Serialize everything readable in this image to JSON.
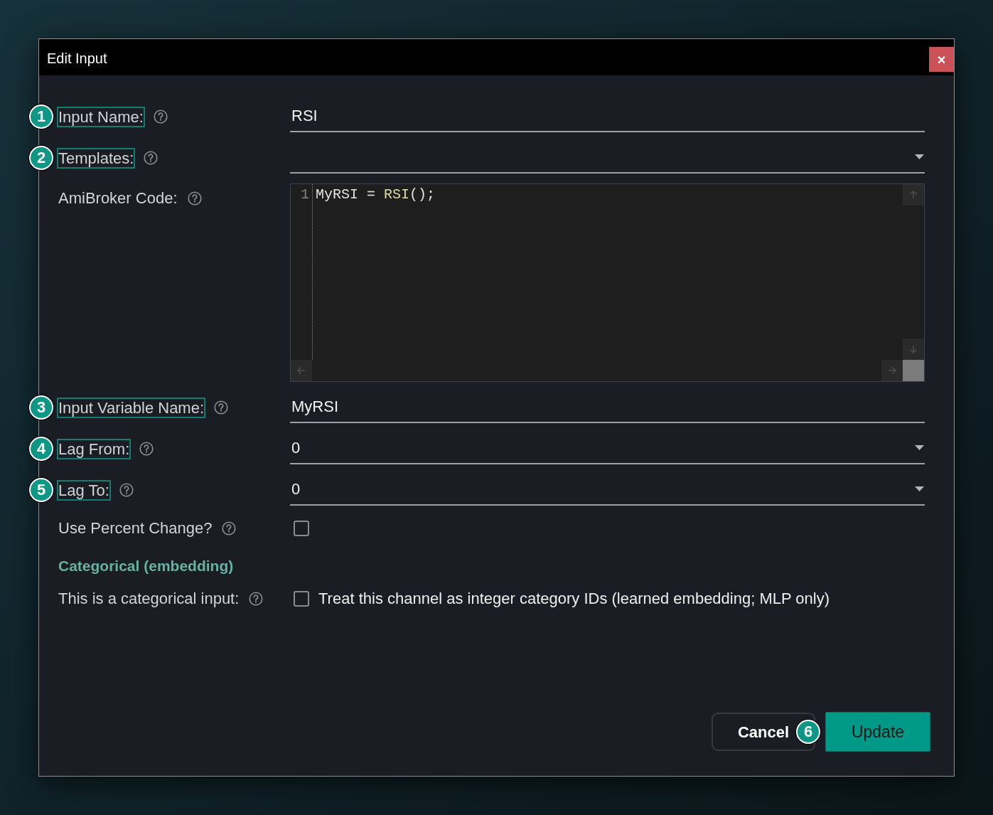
{
  "window": {
    "title": "Edit Input",
    "close_label": "×"
  },
  "fields": [
    {
      "kind": "text",
      "label": "Input Name:",
      "marker": "1",
      "highlighted": true,
      "value": "RSI"
    },
    {
      "kind": "select",
      "label": "Templates:",
      "marker": "2",
      "highlighted": true
    },
    {
      "kind": "code",
      "label": "AmiBroker Code:",
      "highlighted": false,
      "lines": [
        {
          "number": "1",
          "tokens": [
            {
              "text": "MyRSI = ",
              "kind": "plain"
            },
            {
              "text": "RSI",
              "kind": "function"
            },
            {
              "text": "();",
              "kind": "plain"
            }
          ]
        }
      ]
    },
    {
      "kind": "text",
      "label": "Input Variable Name:",
      "marker": "3",
      "highlighted": true,
      "value": "MyRSI"
    },
    {
      "kind": "select",
      "label": "Lag From:",
      "marker": "4",
      "highlighted": true,
      "value": "0"
    },
    {
      "kind": "select",
      "label": "Lag To:",
      "marker": "5",
      "highlighted": true,
      "value": "0"
    },
    {
      "kind": "checkbox",
      "label": "Use Percent Change?",
      "highlighted": false,
      "checked": false
    },
    {
      "kind": "heading",
      "label": "Categorical (embedding)"
    },
    {
      "kind": "checkbox",
      "label": "This is a categorical input:",
      "highlighted": false,
      "checked": false,
      "caption": "Treat this channel as integer category IDs (learned embedding; MLP only)"
    }
  ],
  "buttons": [
    {
      "label": "Cancel",
      "kind": "secondary",
      "marker": "6"
    },
    {
      "label": "Update",
      "kind": "primary"
    }
  ]
}
